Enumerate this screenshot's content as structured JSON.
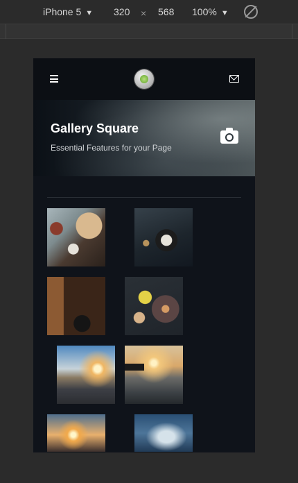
{
  "devtools": {
    "device_name": "iPhone 5",
    "width": "320",
    "times": "×",
    "height": "568",
    "zoom": "100%",
    "caret": "▼"
  },
  "nav": {
    "menu_icon": "hamburger-icon",
    "logo_icon": "logo",
    "mail_icon": "envelope-icon"
  },
  "hero": {
    "title": "Gallery Square",
    "subtitle": "Essential Features for your Page",
    "icon": "camera-icon"
  },
  "gallery": {
    "items": [
      {
        "name": "food-breakfast"
      },
      {
        "name": "food-plate-dark"
      },
      {
        "name": "kitchen-tray"
      },
      {
        "name": "cookies-flowers"
      },
      {
        "name": "coastal-road-sunset"
      },
      {
        "name": "pier-sunset"
      },
      {
        "name": "person-sunset"
      },
      {
        "name": "sky-clouds"
      }
    ]
  }
}
